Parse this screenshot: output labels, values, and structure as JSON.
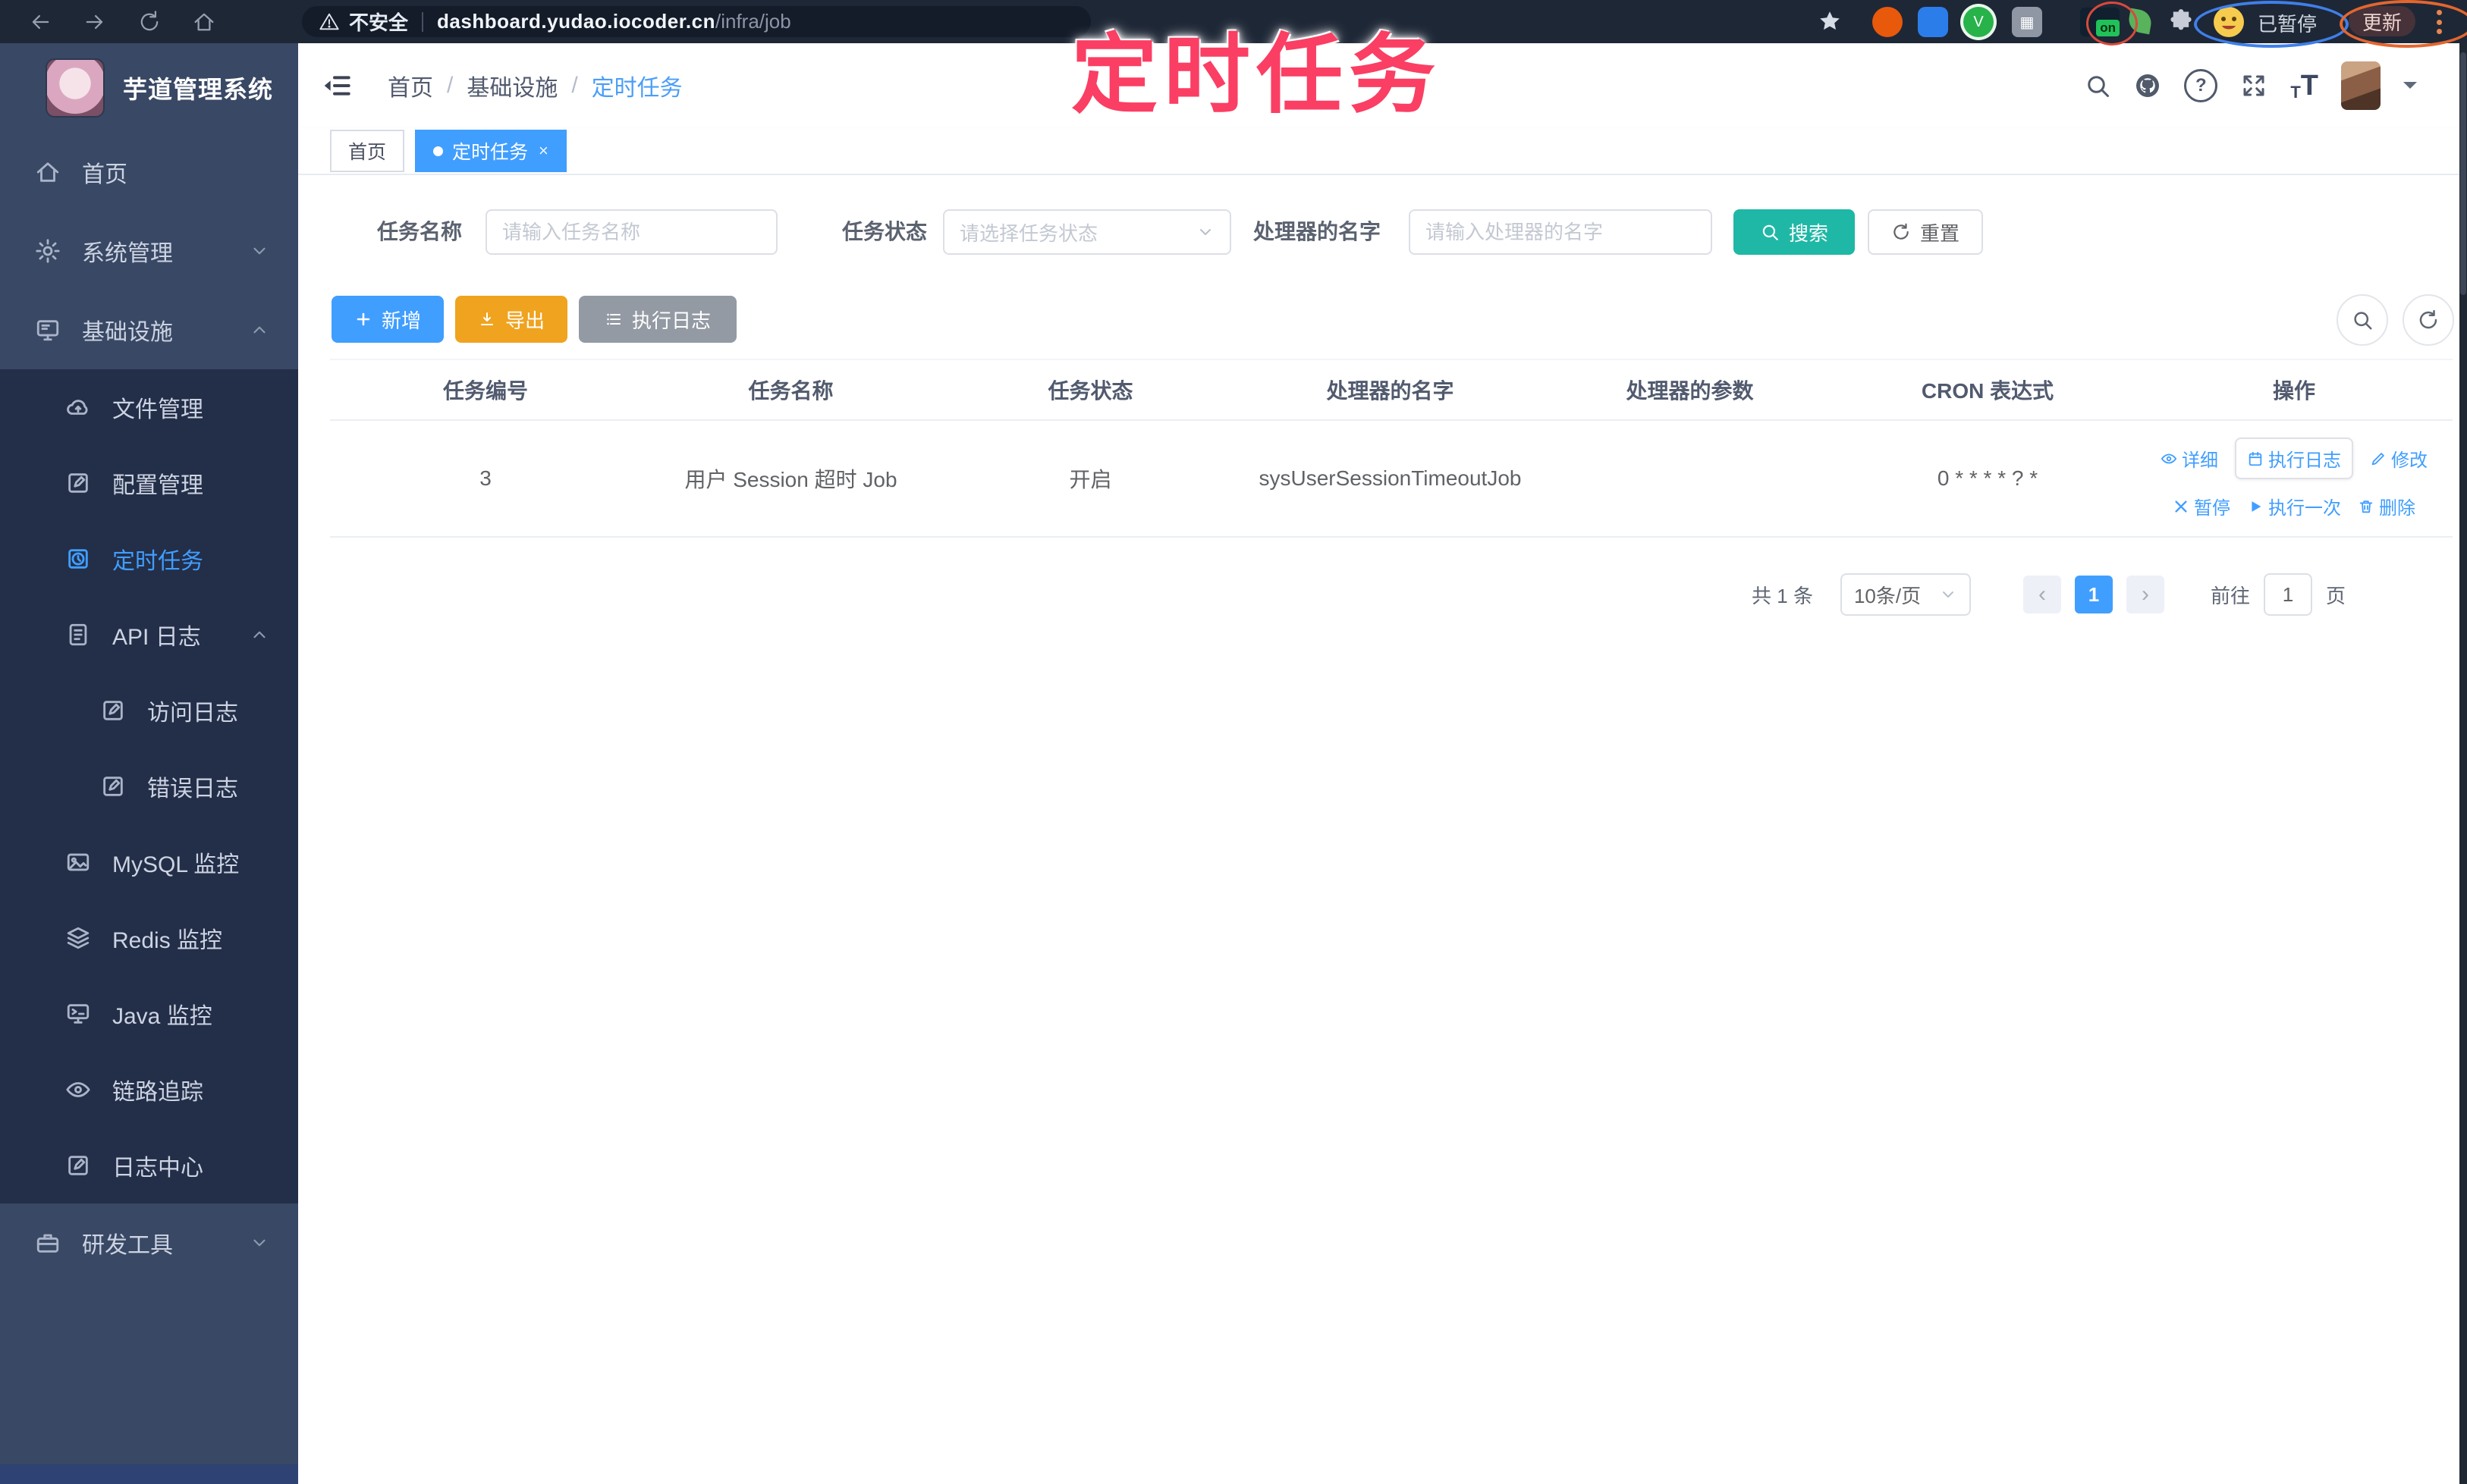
{
  "annotation": {
    "overlay_text": "定时任务"
  },
  "browser": {
    "security_label": "不安全",
    "url_domain": "dashboard.yudao.iocoder.cn",
    "url_path": "/infra/job",
    "extension_badge": "on",
    "profile_label": "已暂停",
    "update_label": "更新"
  },
  "sidebar": {
    "app_title": "芋道管理系统",
    "items": [
      {
        "label": "首页",
        "icon": "home-icon"
      },
      {
        "label": "系统管理",
        "icon": "gear-icon"
      },
      {
        "label": "基础设施",
        "icon": "infra-icon"
      },
      {
        "label": "文件管理",
        "icon": "cloud-icon"
      },
      {
        "label": "配置管理",
        "icon": "edit-icon"
      },
      {
        "label": "定时任务",
        "icon": "timer-icon",
        "active": true
      },
      {
        "label": "API 日志",
        "icon": "log-icon"
      },
      {
        "label": "访问日志",
        "icon": "doc-icon"
      },
      {
        "label": "错误日志",
        "icon": "doc-icon"
      },
      {
        "label": "MySQL 监控",
        "icon": "mysql-icon"
      },
      {
        "label": "Redis 监控",
        "icon": "redis-icon"
      },
      {
        "label": "Java 监控",
        "icon": "java-icon"
      },
      {
        "label": "链路追踪",
        "icon": "trace-eye-icon"
      },
      {
        "label": "日志中心",
        "icon": "log-center-icon"
      },
      {
        "label": "研发工具",
        "icon": "toolbox-icon"
      }
    ]
  },
  "header": {
    "breadcrumb_1": "首页",
    "breadcrumb_2": "基础设施",
    "breadcrumb_3": "定时任务",
    "breadcrumb_sep": "/",
    "help_glyph": "?",
    "font_size_glyph": "T"
  },
  "tabs": {
    "tab_1": "首页",
    "tab_2": "定时任务",
    "close_glyph": "×"
  },
  "filters": {
    "name_label": "任务名称",
    "name_placeholder": "请输入任务名称",
    "status_label": "任务状态",
    "status_placeholder": "请选择任务状态",
    "handler_label": "处理器的名字",
    "handler_placeholder": "请输入处理器的名字",
    "search_label": "搜索",
    "reset_label": "重置"
  },
  "toolbar": {
    "add_label": "新增",
    "export_label": "导出",
    "exec_log_label": "执行日志"
  },
  "table": {
    "columns": [
      "任务编号",
      "任务名称",
      "任务状态",
      "处理器的名字",
      "处理器的参数",
      "CRON 表达式",
      "操作"
    ],
    "rows": [
      {
        "id": "3",
        "name": "用户 Session 超时 Job",
        "status": "开启",
        "handler": "sysUserSessionTimeoutJob",
        "param": "",
        "cron": "0 * * * * ? *"
      }
    ]
  },
  "row_actions": {
    "detail": "详细",
    "exec_log": "执行日志",
    "edit": "修改",
    "pause": "暂停",
    "run_once": "执行一次",
    "delete": "删除"
  },
  "pagination": {
    "total": "共 1 条",
    "page_size": "10条/页",
    "prev_glyph": "‹",
    "page": "1",
    "next_glyph": "›",
    "goto_label": "前往",
    "goto_value": "1",
    "unit_label": "页"
  },
  "colors": {
    "primary": "#409eff",
    "search_teal": "#1fb8a6",
    "export_amber": "#f0a31f",
    "info_gray": "#939aa3",
    "sidebar_bg": "#394864",
    "submenu_bg": "#232e48",
    "chrome_bg": "#1e2736",
    "annotation_pink": "#fb3e63"
  }
}
